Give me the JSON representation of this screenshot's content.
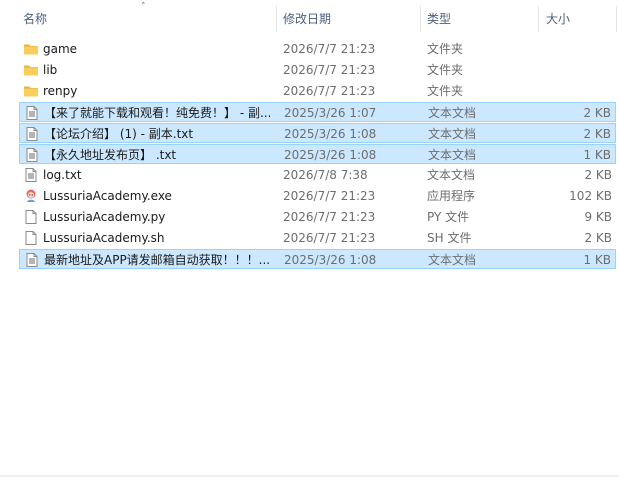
{
  "columns": {
    "name": "名称",
    "date": "修改日期",
    "type": "类型",
    "size": "大小"
  },
  "files": [
    {
      "name": "game",
      "date": "2026/7/7 21:23",
      "type": "文件夹",
      "size": "",
      "icon": "folder-icon",
      "selected": false
    },
    {
      "name": "lib",
      "date": "2026/7/7 21:23",
      "type": "文件夹",
      "size": "",
      "icon": "folder-icon",
      "selected": false
    },
    {
      "name": "renpy",
      "date": "2026/7/7 21:23",
      "type": "文件夹",
      "size": "",
      "icon": "folder-icon",
      "selected": false
    },
    {
      "name": "【来了就能下载和观看！纯免费！】 - 副...",
      "date": "2025/3/26 1:07",
      "type": "文本文档",
      "size": "2 KB",
      "icon": "text-file-icon",
      "selected": true
    },
    {
      "name": "【论坛介绍】 (1) - 副本.txt",
      "date": "2025/3/26 1:08",
      "type": "文本文档",
      "size": "2 KB",
      "icon": "text-file-icon",
      "selected": true
    },
    {
      "name": "【永久地址发布页】 .txt",
      "date": "2025/3/26 1:08",
      "type": "文本文档",
      "size": "1 KB",
      "icon": "text-file-icon",
      "selected": true
    },
    {
      "name": "log.txt",
      "date": "2026/7/8 7:38",
      "type": "文本文档",
      "size": "2 KB",
      "icon": "text-file-icon",
      "selected": false
    },
    {
      "name": "LussuriaAcademy.exe",
      "date": "2026/7/7 21:23",
      "type": "应用程序",
      "size": "102 KB",
      "icon": "app-icon",
      "selected": false
    },
    {
      "name": "LussuriaAcademy.py",
      "date": "2026/7/7 21:23",
      "type": "PY 文件",
      "size": "9 KB",
      "icon": "file-icon",
      "selected": false
    },
    {
      "name": "LussuriaAcademy.sh",
      "date": "2026/7/7 21:23",
      "type": "SH 文件",
      "size": "2 KB",
      "icon": "file-icon",
      "selected": false
    },
    {
      "name": "最新地址及APP请发邮箱自动获取！！！...",
      "date": "2025/3/26 1:08",
      "type": "文本文档",
      "size": "1 KB",
      "icon": "text-file-icon",
      "selected": true
    }
  ],
  "colors": {
    "selection_bg": "#cce8ff",
    "selection_border": "#99d1ff",
    "header_text": "#4c607a",
    "folder": "#f5c04a"
  }
}
